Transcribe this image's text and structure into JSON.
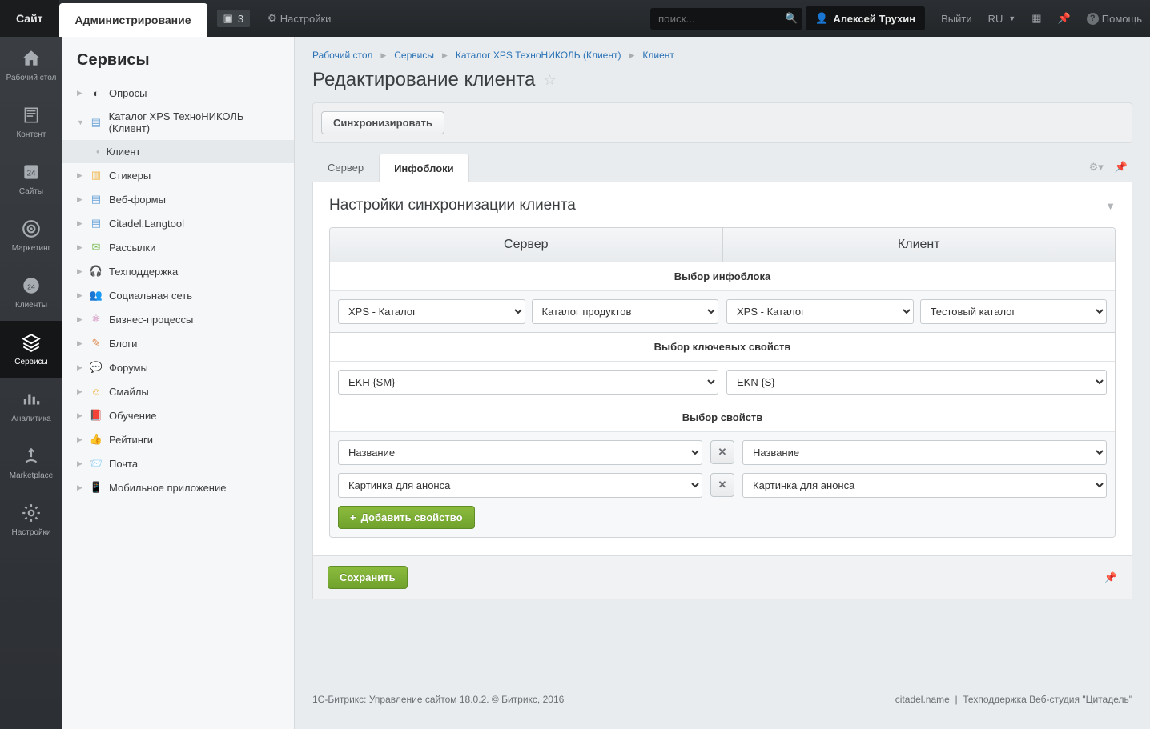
{
  "topbar": {
    "site_tab": "Сайт",
    "admin_tab": "Администрирование",
    "notif_count": "3",
    "settings": "Настройки",
    "search_placeholder": "поиск...",
    "user_name": "Алексей Трухин",
    "logout": "Выйти",
    "lang": "RU",
    "help": "Помощь"
  },
  "leftbar": [
    {
      "label": "Рабочий стол"
    },
    {
      "label": "Контент"
    },
    {
      "label": "Сайты"
    },
    {
      "label": "Маркетинг"
    },
    {
      "label": "Клиенты"
    },
    {
      "label": "Сервисы"
    },
    {
      "label": "Аналитика"
    },
    {
      "label": "Marketplace"
    },
    {
      "label": "Настройки"
    }
  ],
  "sidebar": {
    "title": "Сервисы",
    "items": [
      {
        "label": "Опросы"
      },
      {
        "label": "Каталог XPS ТехноНИКОЛЬ (Клиент)",
        "expanded": true,
        "children": [
          "Клиент"
        ]
      },
      {
        "label": "Стикеры"
      },
      {
        "label": "Веб-формы"
      },
      {
        "label": "Citadel.Langtool"
      },
      {
        "label": "Рассылки"
      },
      {
        "label": "Техподдержка"
      },
      {
        "label": "Социальная сеть"
      },
      {
        "label": "Бизнес-процессы"
      },
      {
        "label": "Блоги"
      },
      {
        "label": "Форумы"
      },
      {
        "label": "Смайлы"
      },
      {
        "label": "Обучение"
      },
      {
        "label": "Рейтинги"
      },
      {
        "label": "Почта"
      },
      {
        "label": "Мобильное приложение"
      }
    ]
  },
  "breadcrumb": [
    "Рабочий стол",
    "Сервисы",
    "Каталог XPS ТехноНИКОЛЬ (Клиент)",
    "Клиент"
  ],
  "page_title": "Редактирование клиента",
  "sync_button": "Синхронизировать",
  "tabs": {
    "server": "Сервер",
    "infoblocks": "Инфоблоки"
  },
  "panel": {
    "heading": "Настройки синхронизации клиента",
    "col_server": "Сервер",
    "col_client": "Клиент",
    "sub_infoblock": "Выбор инфоблока",
    "sub_keyprops": "Выбор ключевых свойств",
    "sub_props": "Выбор свойств",
    "server_infoblock_type": "XPS - Каталог",
    "server_infoblock": "Каталог продуктов",
    "client_infoblock_type": "XPS - Каталог",
    "client_infoblock": "Тестовый каталог",
    "server_key": "EKH {SM}",
    "client_key": "EKN {S}",
    "prop1_server": "Название",
    "prop1_client": "Название",
    "prop2_server": "Картинка для анонса",
    "prop2_client": "Картинка для анонса",
    "add_prop": "Добавить свойство",
    "save": "Сохранить"
  },
  "footer": {
    "left": "1С-Битрикс: Управление сайтом 18.0.2. © Битрикс, 2016",
    "right_site": "citadel.name",
    "right_support": "Техподдержка Веб-студия \"Цитадель\""
  }
}
